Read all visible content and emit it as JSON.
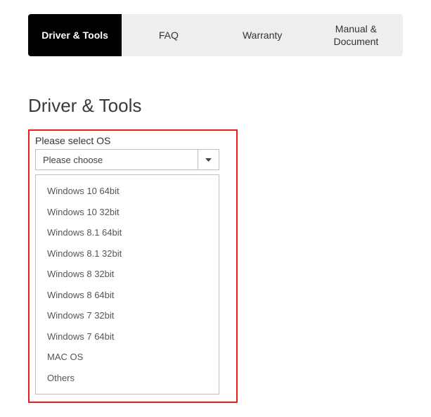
{
  "tabs": {
    "driver_tools": "Driver & Tools",
    "faq": "FAQ",
    "warranty": "Warranty",
    "manual_document": "Manual & Document"
  },
  "heading": "Driver & Tools",
  "select": {
    "label": "Please select OS",
    "placeholder": "Please choose",
    "options": [
      "Windows 10 64bit",
      "Windows 10 32bit",
      "Windows 8.1 64bit",
      "Windows 8.1 32bit",
      "Windows 8 32bit",
      "Windows 8 64bit",
      "Windows 7 32bit",
      "Windows 7 64bit",
      "MAC OS",
      "Others"
    ]
  }
}
